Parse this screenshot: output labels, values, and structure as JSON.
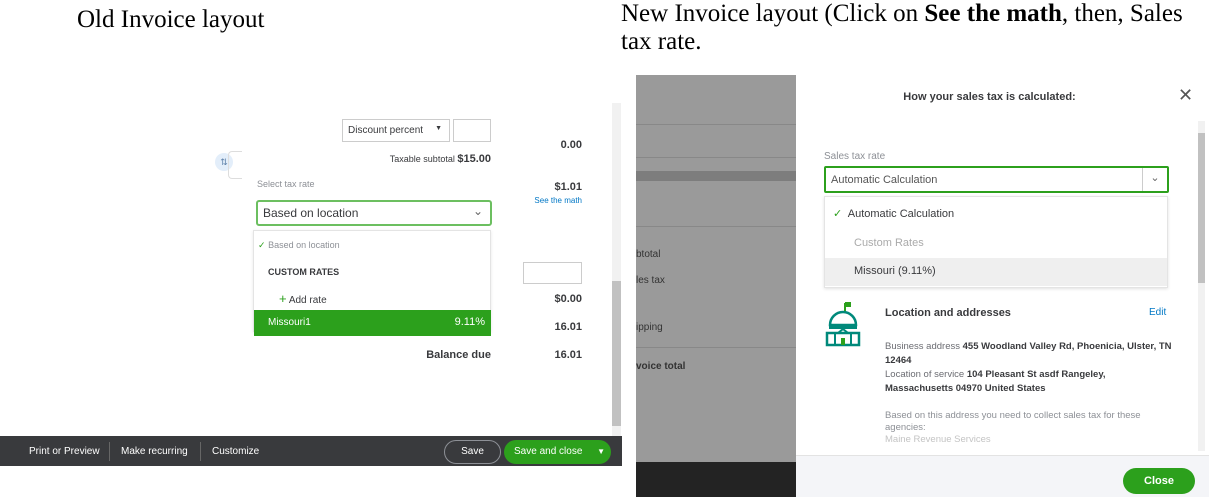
{
  "captions": {
    "old": "Old Invoice layout",
    "new_pre": "New Invoice layout (Click on ",
    "new_bold": "See the math",
    "new_post": ", then, Sales tax rate."
  },
  "old": {
    "discount_select": "Discount percent",
    "discount_amount": "0.00",
    "taxable_label": "Taxable subtotal",
    "taxable_value": "$15.00",
    "tax_label": "Select tax rate",
    "tax_select": "Based on location",
    "tax_amount": "$1.01",
    "see_math": "See the math",
    "menu": {
      "selected": "Based on location",
      "header": "CUSTOM RATES",
      "add": "Add rate",
      "item_name": "Missouri1",
      "item_rate": "9.11%"
    },
    "shipping_value": "$0.00",
    "total_value": "16.01",
    "balance_label": "Balance due",
    "balance_value": "16.01",
    "footer": {
      "print": "Print or Preview",
      "recurring": "Make recurring",
      "customize": "Customize",
      "save": "Save",
      "save_close": "Save and close"
    }
  },
  "new": {
    "bg_labels": [
      "btotal",
      "les tax",
      "ipping",
      "voice total"
    ],
    "title": "How your sales tax is calculated:",
    "rate_label": "Sales tax rate",
    "rate_value": "Automatic Calculation",
    "options": {
      "auto": "Automatic Calculation",
      "custom_header": "Custom Rates",
      "missouri": "Missouri (9.11%)"
    },
    "loc_title": "Location and addresses",
    "edit": "Edit",
    "business_label": "Business address",
    "business_value": "455 Woodland Valley Rd, Phoenicia, Ulster, TN 12464",
    "service_label": "Location of service",
    "service_value": "104 Pleasant St asdf Rangeley, Massachusetts 04970 United States",
    "agencies_text": "Based on this address you need to collect sales tax for these agencies:",
    "agency": "Maine Revenue Services",
    "close": "Close"
  },
  "colors": {
    "green": "#2ca01c",
    "link": "#0077c5",
    "dark": "#393a3d"
  }
}
